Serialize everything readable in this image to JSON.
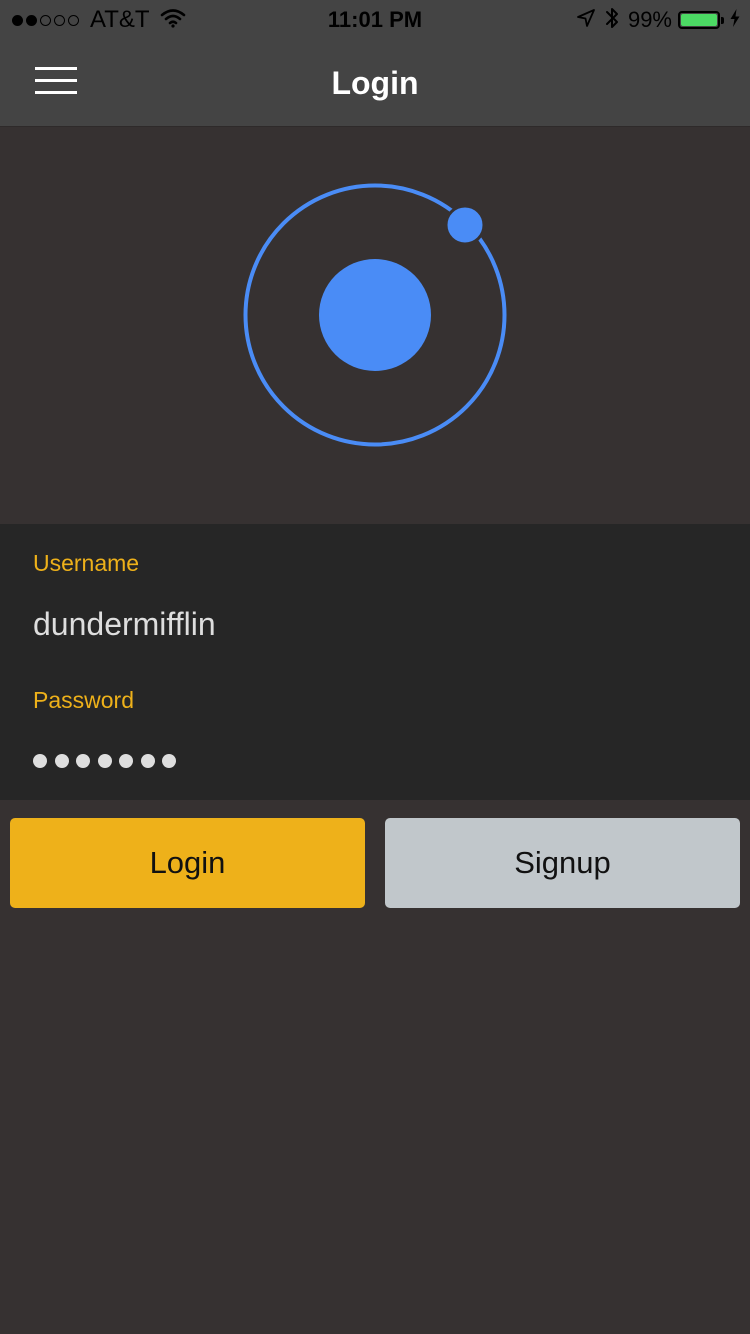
{
  "status_bar": {
    "signal_strength": 2,
    "signal_max": 5,
    "carrier": "AT&T",
    "time": "11:01 PM",
    "battery_percent": "99%",
    "battery_level": 0.99,
    "battery_color": "#4cd964",
    "icons": [
      "wifi-icon",
      "location-arrow-icon",
      "bluetooth-icon",
      "battery-icon",
      "charging-bolt-icon"
    ]
  },
  "header": {
    "title": "Login",
    "menu_icon": "hamburger-menu-icon"
  },
  "logo": {
    "icon": "ionic-logo-icon",
    "color": "#4a8cf6"
  },
  "form": {
    "username": {
      "label": "Username",
      "value": "dundermifflin"
    },
    "password": {
      "label": "Password",
      "masked_length": 7
    }
  },
  "buttons": {
    "login": "Login",
    "signup": "Signup"
  },
  "colors": {
    "accent": "#eeb11a",
    "secondary_button": "#c1c7cb",
    "background": "#363131",
    "header": "#444444",
    "form_background": "#262626"
  }
}
